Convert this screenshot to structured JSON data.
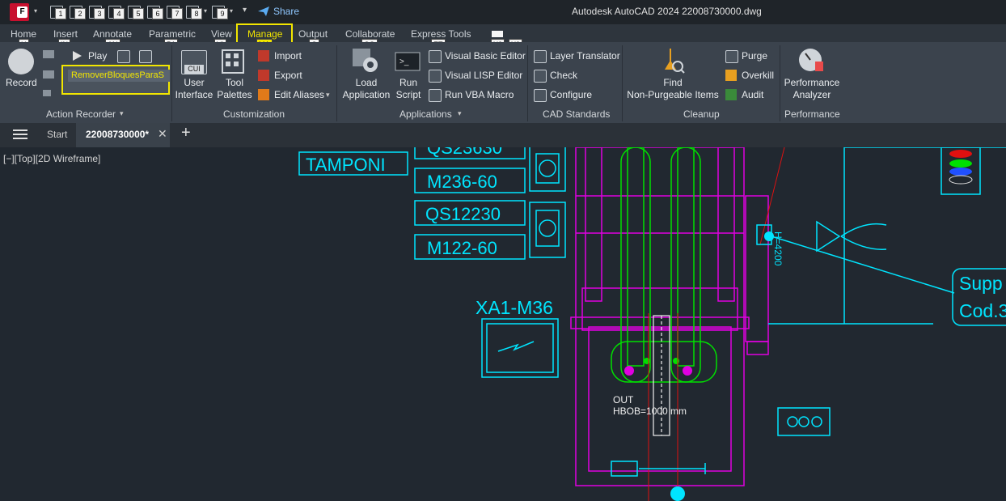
{
  "app": {
    "logo_letter": "F",
    "window_title": "Autodesk AutoCAD 2024    22008730000.dwg",
    "share_label": "Share",
    "qat_badges": [
      "1",
      "2",
      "3",
      "4",
      "5",
      "6",
      "7",
      "8",
      "9"
    ]
  },
  "ribbon_tabs": [
    {
      "label": "Home",
      "key": "H"
    },
    {
      "label": "Insert",
      "key": "IN"
    },
    {
      "label": "Annotate",
      "key": "AN"
    },
    {
      "label": "Parametric",
      "key": "PA"
    },
    {
      "label": "View",
      "key": "VI"
    },
    {
      "label": "Manage",
      "key": "MA",
      "active": true
    },
    {
      "label": "Output",
      "key": "O"
    },
    {
      "label": "Collaborate",
      "key": "CO"
    },
    {
      "label": "Express Tools",
      "key": "ET"
    }
  ],
  "extra_keytips": [
    "X2",
    "X3"
  ],
  "panels": {
    "action_recorder": {
      "title": "Action Recorder",
      "record": "Record",
      "play": "Play",
      "macro_value": "RemoverBloquesParaS"
    },
    "customization": {
      "title": "Customization",
      "cui_badge": "CUI",
      "user_interface": [
        "User",
        "Interface"
      ],
      "tool_palettes": [
        "Tool",
        "Palettes"
      ],
      "import": "Import",
      "export": "Export",
      "edit_aliases": "Edit Aliases"
    },
    "applications": {
      "title": "Applications",
      "load_application": [
        "Load",
        "Application"
      ],
      "run_script": [
        "Run",
        "Script"
      ],
      "visual_basic_editor": "Visual Basic Editor",
      "visual_lisp_editor": "Visual LISP Editor",
      "run_vba_macro": "Run VBA Macro"
    },
    "cad_standards": {
      "title": "CAD Standards",
      "layer_translator": "Layer Translator",
      "check": "Check",
      "configure": "Configure"
    },
    "cleanup": {
      "title": "Cleanup",
      "find_non_purgeable": [
        "Find",
        "Non-Purgeable Items"
      ],
      "purge": "Purge",
      "overkill": "Overkill",
      "audit": "Audit"
    },
    "performance": {
      "title": "Performance",
      "performance_analyzer": [
        "Performance",
        "Analyzer"
      ]
    }
  },
  "doc_tabs": {
    "start": "Start",
    "active": "22008730000*"
  },
  "viewport": {
    "label": "[−][Top][2D Wireframe]"
  },
  "drawing_text": {
    "qs23630_partial": "QS23630",
    "tamponi": "TAMPONI",
    "m236": "M236-60",
    "qs12230": "QS12230",
    "m122": "M122-60",
    "xa1": "XA1-M36",
    "out": "OUT",
    "hbob": "HBOB=1000 mm",
    "h4200": "H=4200",
    "supp_partial": "Supp",
    "cod_partial": "Cod.3"
  },
  "colors": {
    "cyan": "#00e5ff",
    "magenta": "#e000e0",
    "green": "#00e000",
    "white": "#f0f0f0",
    "red": "#e01010",
    "highlight": "#f2e600"
  }
}
